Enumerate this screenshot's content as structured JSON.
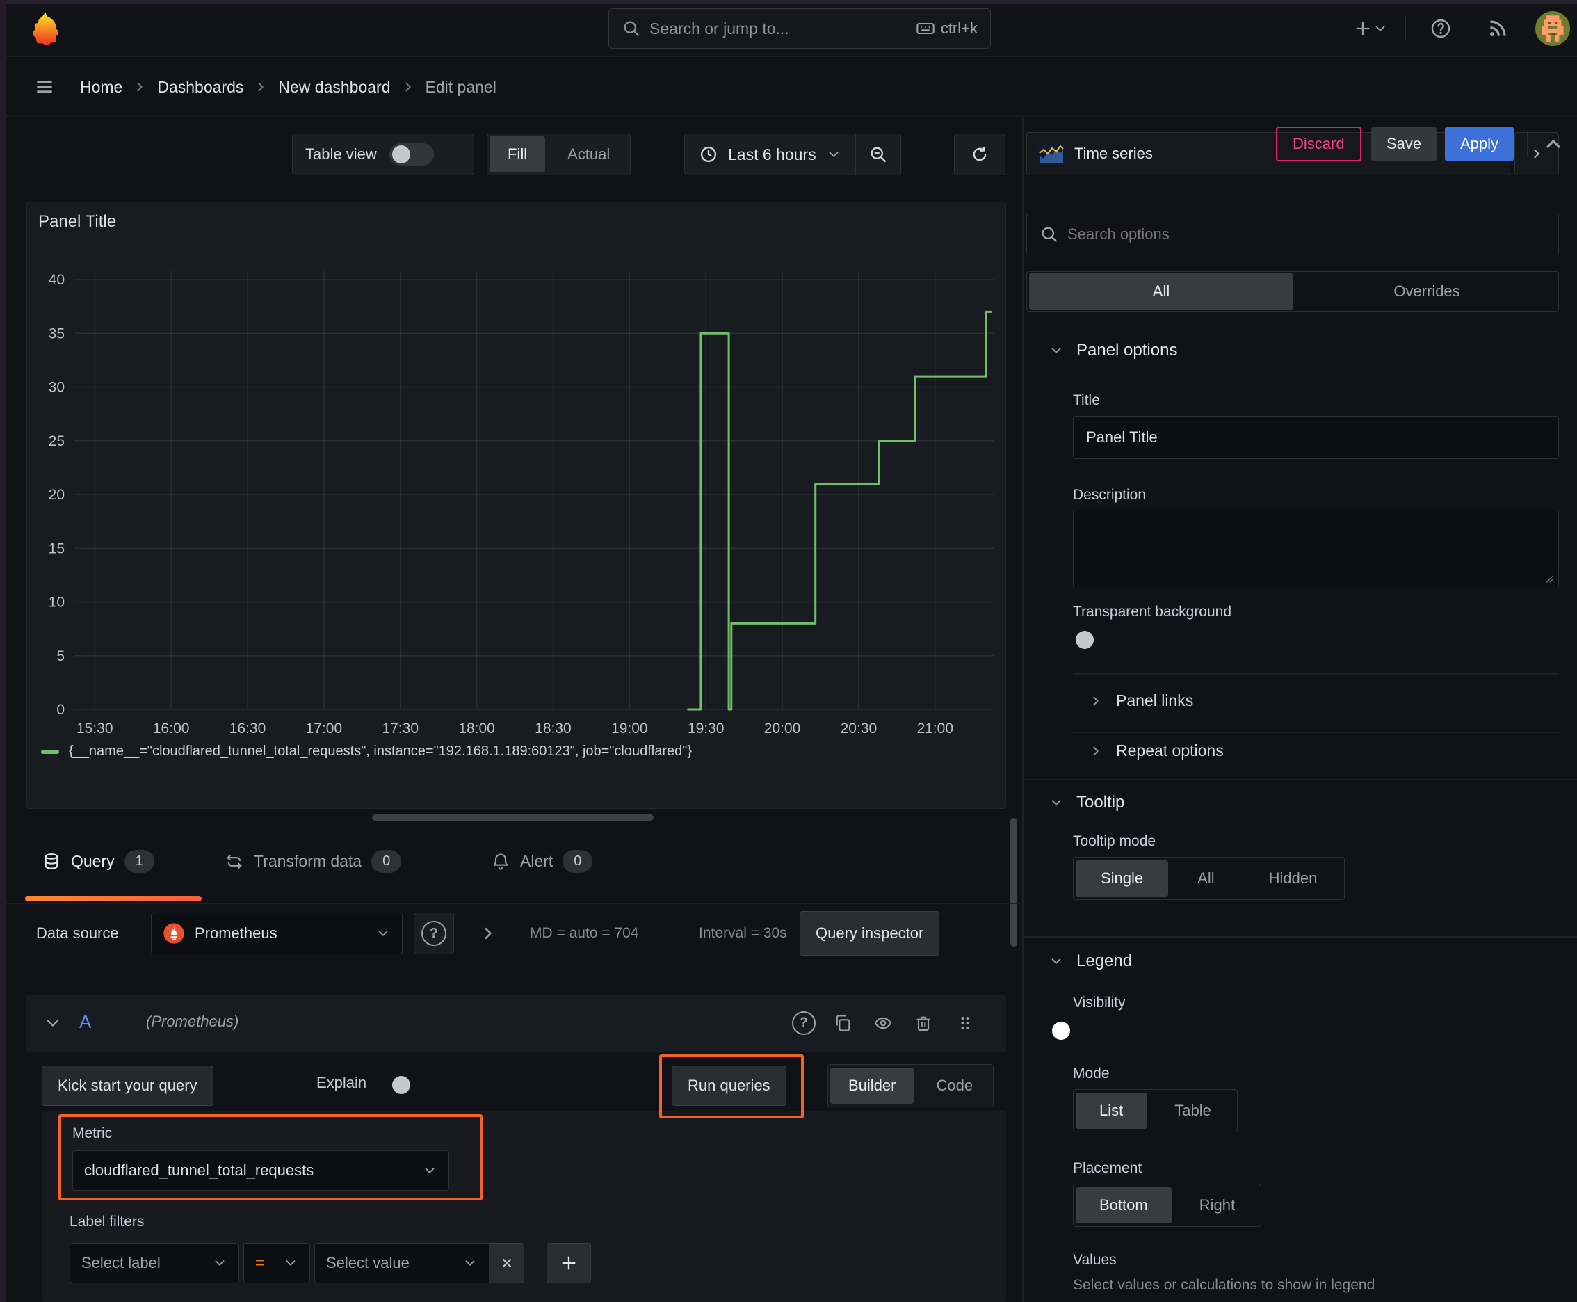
{
  "topnav": {
    "search_placeholder": "Search or jump to...",
    "shortcut": "ctrl+k"
  },
  "breadcrumb": {
    "items": [
      "Home",
      "Dashboards",
      "New dashboard",
      "Edit panel"
    ]
  },
  "actions": {
    "discard": "Discard",
    "save": "Save",
    "apply": "Apply"
  },
  "panel_toolbar": {
    "table_view": "Table view",
    "fill": "Fill",
    "actual": "Actual",
    "time_range": "Last 6 hours"
  },
  "panel": {
    "title": "Panel Title"
  },
  "chart_data": {
    "type": "line",
    "line_style": "step-after",
    "title": "Panel Title",
    "color": "#73BF69",
    "series_label": "{__name__=\"cloudflared_tunnel_total_requests\", instance=\"192.168.1.189:60123\", job=\"cloudflared\"}",
    "x_domain": [
      "15:22",
      "21:23"
    ],
    "x_ticks": [
      "15:30",
      "16:00",
      "16:30",
      "17:00",
      "17:30",
      "18:00",
      "18:30",
      "19:00",
      "19:30",
      "20:00",
      "20:30",
      "21:00"
    ],
    "y_ticks": [
      0,
      5,
      10,
      15,
      20,
      25,
      30,
      35,
      40
    ],
    "ylim": [
      0,
      41
    ],
    "grid": true,
    "legend_position": "bottom",
    "points": [
      [
        "19:23",
        0
      ],
      [
        "19:28",
        0
      ],
      [
        "19:28",
        35
      ],
      [
        "19:39",
        35
      ],
      [
        "19:39",
        0
      ],
      [
        "19:40",
        0
      ],
      [
        "19:40",
        8
      ],
      [
        "20:13",
        8
      ],
      [
        "20:13",
        21
      ],
      [
        "20:38",
        21
      ],
      [
        "20:38",
        25
      ],
      [
        "20:52",
        25
      ],
      [
        "20:52",
        31
      ],
      [
        "21:20",
        31
      ],
      [
        "21:20",
        37
      ],
      [
        "21:22",
        37
      ]
    ]
  },
  "tabs": {
    "query": {
      "label": "Query",
      "count": "1"
    },
    "transform": {
      "label": "Transform data",
      "count": "0"
    },
    "alert": {
      "label": "Alert",
      "count": "0"
    }
  },
  "datasource_row": {
    "label": "Data source",
    "name": "Prometheus",
    "md_text": "MD = auto = 704",
    "interval_text": "Interval = 30s",
    "inspector": "Query inspector"
  },
  "query_row": {
    "ref_id": "A",
    "ds_hint": "(Prometheus)"
  },
  "query_actions": {
    "kickstart": "Kick start your query",
    "explain": "Explain",
    "run": "Run queries",
    "builder": "Builder",
    "code": "Code"
  },
  "metric": {
    "label": "Metric",
    "value": "cloudflared_tunnel_total_requests"
  },
  "label_filters": {
    "label": "Label filters",
    "select_label_placeholder": "Select label",
    "operator": "=",
    "select_value_placeholder": "Select value"
  },
  "sidebar": {
    "visualization": "Time series",
    "search_placeholder": "Search options",
    "filter_tabs": {
      "all": "All",
      "overrides": "Overrides"
    },
    "panel_options": {
      "heading": "Panel options",
      "title_label": "Title",
      "title_value": "Panel Title",
      "description_label": "Description",
      "transparent_label": "Transparent background"
    },
    "panel_links": "Panel links",
    "repeat_options": "Repeat options",
    "tooltip": {
      "heading": "Tooltip",
      "mode_label": "Tooltip mode",
      "modes": [
        "Single",
        "All",
        "Hidden"
      ],
      "selected": "Single"
    },
    "legend": {
      "heading": "Legend",
      "visibility_label": "Visibility",
      "mode_label": "Mode",
      "modes": [
        "List",
        "Table"
      ],
      "placement_label": "Placement",
      "placements": [
        "Bottom",
        "Right"
      ],
      "values_label": "Values",
      "values_hint": "Select values or calculations to show in legend"
    }
  },
  "colors": {
    "accent_blue": "#3d71d9",
    "annotation_orange": "#f56322",
    "tab_underline": "#ff8833",
    "series_green": "#73BF69",
    "discard_pink": "#e0226e",
    "prometheus_orange": "#e6522c"
  }
}
